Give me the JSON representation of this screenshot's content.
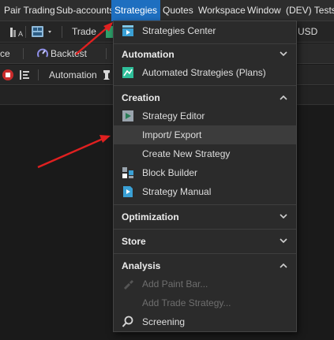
{
  "menubar": {
    "items": [
      {
        "label": "Pair Trading"
      },
      {
        "label": "Sub-accounts"
      },
      {
        "label": "Strategies"
      },
      {
        "label": "Quotes"
      },
      {
        "label": "Workspace"
      },
      {
        "label": "Window"
      },
      {
        "label": "(DEV) Tests"
      }
    ]
  },
  "toolbar1": {
    "trade_label": "Trade",
    "currency_label": "USD",
    "a_subscript": "A"
  },
  "toolbar2": {
    "left_label": "ce",
    "backtest_label": "Backtest"
  },
  "toolbar3": {
    "automation_label": "Automation"
  },
  "dropdown": {
    "top_item": {
      "label": "Strategies Center",
      "icon": "strategies-center-icon"
    },
    "sections": {
      "automation": {
        "title": "Automation",
        "items": [
          {
            "label": "Automated Strategies (Plans)",
            "icon": "automated-strategies-icon"
          }
        ]
      },
      "creation": {
        "title": "Creation",
        "items": [
          {
            "label": "Strategy Editor",
            "icon": "strategy-editor-icon"
          },
          {
            "label": "Import/ Export"
          },
          {
            "label": "Create New Strategy"
          },
          {
            "label": "Block Builder",
            "icon": "block-builder-icon"
          },
          {
            "label": "Strategy Manual",
            "icon": "strategy-manual-icon"
          }
        ]
      },
      "optimization": {
        "title": "Optimization"
      },
      "store": {
        "title": "Store"
      },
      "analysis": {
        "title": "Analysis",
        "items": [
          {
            "label": "Add Paint Bar...",
            "disabled": true
          },
          {
            "label": "Add Trade Strategy...",
            "disabled": true
          },
          {
            "label": "Screening",
            "icon": "search-icon"
          }
        ]
      }
    }
  },
  "colors": {
    "accent": "#1e6fc0",
    "annotation_arrow": "#e02020"
  }
}
